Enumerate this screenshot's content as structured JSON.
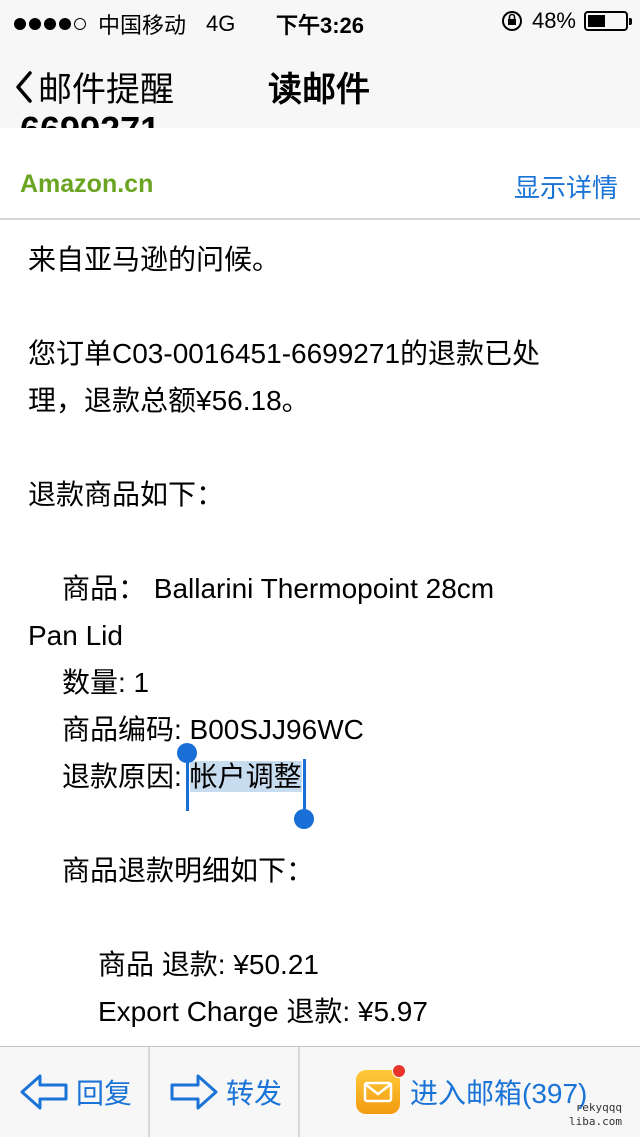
{
  "status_bar": {
    "carrier": "中国移动",
    "network": "4G",
    "time": "下午3:26",
    "battery_percent": "48%",
    "battery_level": 0.48,
    "signal_bars": 4
  },
  "nav": {
    "back_label": "邮件提醒",
    "title": "读邮件"
  },
  "header": {
    "cutoff_text": "6699271",
    "sender": "Amazon.cn",
    "details_link": "显示详情"
  },
  "body": {
    "greeting": "来自亚马逊的问候。",
    "refund_line1": "您订单C03-0016451-6699271的退款已处",
    "refund_line2": "理，退款总额¥56.18。",
    "items_intro": "退款商品如下：",
    "item_label": "商品：",
    "item_name_line1": "Ballarini Thermopoint 28cm",
    "item_name_line2": "Pan Lid",
    "quantity": "数量: 1",
    "item_code": "商品编码: B00SJJ96WC",
    "reason_label": "退款原因: ",
    "reason_value": "帐户调整",
    "detail_intro": "商品退款明细如下：",
    "item_refund": "商品 退款: ¥50.21",
    "export_refund": "Export Charge 退款: ¥5.97"
  },
  "toolbar": {
    "reply": "回复",
    "forward": "转发",
    "inbox": "进入邮箱(397)",
    "watermark_line1": "rekyqqq",
    "watermark_line2": "liba.com"
  },
  "colors": {
    "accent": "#1a73d6",
    "sender": "#6aa422",
    "selection": "#c8dcef"
  }
}
